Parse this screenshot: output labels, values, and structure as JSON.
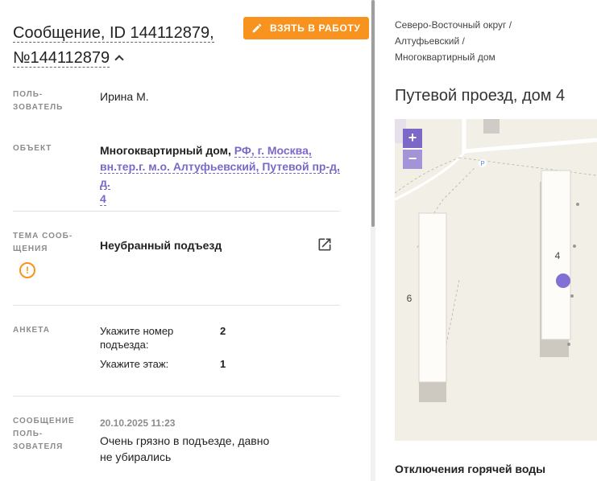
{
  "message": {
    "title_line1": "Сообщение, ID 144112879,",
    "title_line2": "№144112879",
    "take_button": "ВЗЯТЬ В РАБОТУ"
  },
  "fields": {
    "user_label_1": "ПОЛЬ-",
    "user_label_2": "ЗОВАТЕЛЬ",
    "user_value": "Ирина М.",
    "object_label": "ОБЪЕКТ",
    "object_type": "Многоквартирный дом,",
    "object_link_1": "РФ, г. Москва,",
    "object_link_2": "вн.тер.г. м.о. Алтуфьевский, Путевой пр-д, д.",
    "object_link_3": "4",
    "topic_label_1": "ТЕМА СООБ-",
    "topic_label_2": "ЩЕНИЯ",
    "topic_value": "Неубранный подъезд",
    "survey_label": "АНКЕТА",
    "survey_q1_line1": "Укажите номер",
    "survey_q1_line2": "подъезда:",
    "survey_a1": "2",
    "survey_q2": "Укажите этаж:",
    "survey_a2": "1",
    "msg_label_1": "СООБЩЕНИЕ",
    "msg_label_2": "ПОЛЬ-",
    "msg_label_3": "ЗОВАТЕЛЯ",
    "msg_date": "20.10.2025 11:23",
    "msg_text_1": "Очень грязно в подъезде, давно",
    "msg_text_2": "не убирались"
  },
  "right": {
    "crumb_1": "Северо-Восточный округ /",
    "crumb_2": "Алтуфьевский /",
    "crumb_3": "Многоквартирный дом",
    "address": "Путевой проезд, дом 4",
    "map_building_4": "4",
    "map_building_6": "6",
    "map_parking": "P",
    "zoom_in": "+",
    "zoom_out": "−",
    "section_title": "Отключения горячей воды"
  },
  "colors": {
    "accent": "#f7931e",
    "link": "#7c68c7"
  },
  "icons": [
    "pencil-icon",
    "chevron-up-icon",
    "warning-icon",
    "external-link-icon"
  ]
}
